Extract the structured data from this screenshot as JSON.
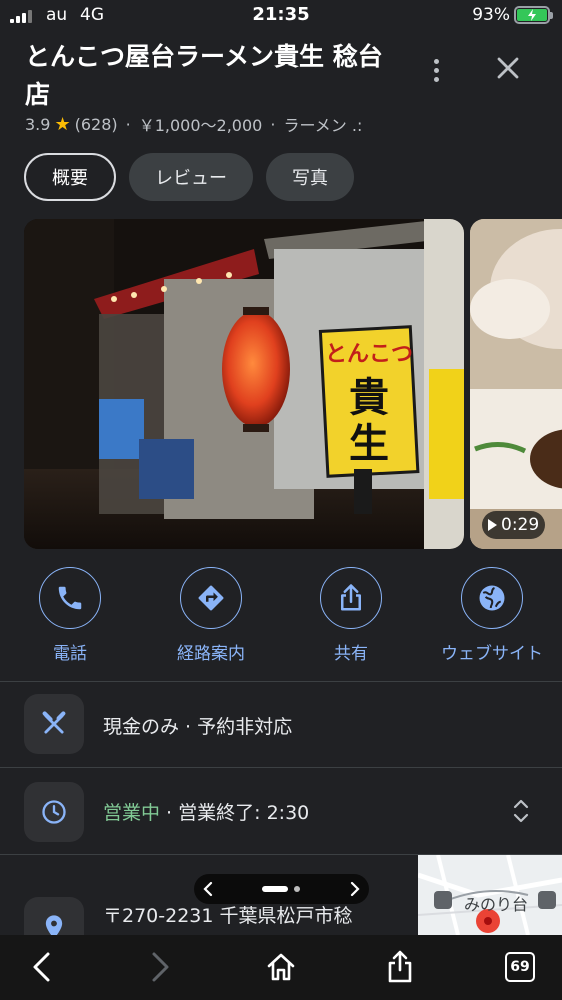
{
  "status_bar": {
    "carrier": "au",
    "network": "4G",
    "time": "21:35",
    "battery": "93%"
  },
  "place": {
    "name": "とんこつ屋台ラーメン貴生 稔台店",
    "rating": "3.9",
    "reviews": "(628)",
    "price": "￥1,000～2,000",
    "category": "ラーメン .:"
  },
  "tabs": [
    {
      "label": "概要",
      "active": true
    },
    {
      "label": "レビュー",
      "active": false
    },
    {
      "label": "写真",
      "active": false
    }
  ],
  "photos": {
    "sign_text_1": "とんこつ",
    "sign_text_2": "貴",
    "sign_text_3": "生",
    "video_duration": "0:29"
  },
  "actions": [
    {
      "label": "電話",
      "icon": "phone-icon"
    },
    {
      "label": "経路案内",
      "icon": "directions-icon"
    },
    {
      "label": "共有",
      "icon": "share-icon"
    },
    {
      "label": "ウェブサイト",
      "icon": "globe-icon"
    }
  ],
  "info": {
    "service": "現金のみ · 予約非対応",
    "hours_status": "営業中",
    "hours_detail": " · 営業終了: 2:30",
    "address": "〒270-2231 千葉県松戸市稔"
  },
  "map": {
    "label": "みのり台"
  },
  "browser": {
    "tab_count": "69"
  },
  "colors": {
    "accent": "#8ab4f8",
    "open": "#81c995",
    "star": "#fbbc04",
    "background": "#202124"
  }
}
